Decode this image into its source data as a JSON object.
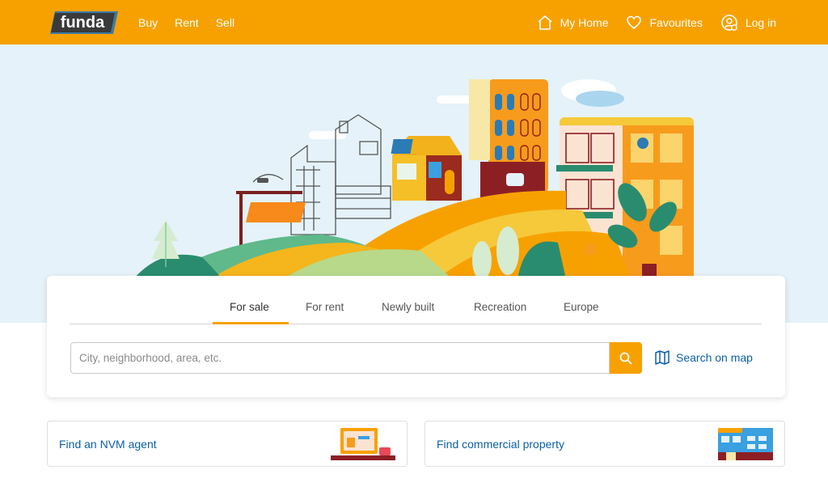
{
  "header": {
    "logo_text": "funda",
    "nav_left": [
      "Buy",
      "Rent",
      "Sell"
    ],
    "my_home": "My Home",
    "favourites": "Favourites",
    "login": "Log in",
    "brand_color": "#f7a100"
  },
  "search": {
    "tabs": [
      "For sale",
      "For rent",
      "Newly built",
      "Recreation",
      "Europe"
    ],
    "active_tab": "For sale",
    "placeholder": "City, neighborhood, area, etc.",
    "value": "",
    "map_link": "Search on map"
  },
  "cards": {
    "agent": "Find an NVM agent",
    "commercial": "Find commercial property"
  },
  "icons": [
    "home-icon",
    "heart-icon",
    "user-icon",
    "search-icon",
    "map-icon"
  ],
  "colors": {
    "accent": "#f7a100",
    "link": "#0b5fa5",
    "hero_bg": "#e5f2f9"
  }
}
